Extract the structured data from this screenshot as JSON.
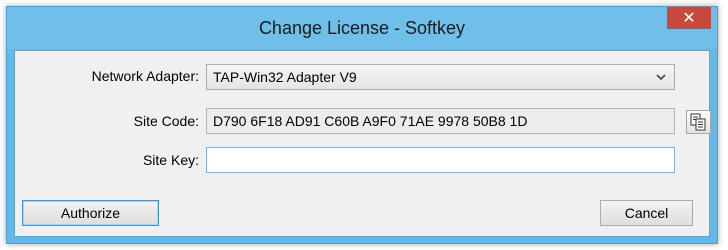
{
  "window": {
    "title": "Change License - Softkey",
    "close_glyph": "✕"
  },
  "form": {
    "network_adapter_label": "Network Adapter:",
    "network_adapter_value": "TAP-Win32 Adapter V9",
    "site_code_label": "Site Code:",
    "site_code_value": "D790 6F18 AD91 C60B A9F0 71AE 9978 50B8 1D",
    "site_key_label": "Site Key:",
    "site_key_value": ""
  },
  "buttons": {
    "authorize": "Authorize",
    "cancel": "Cancel"
  },
  "icons": {
    "dropdown": "chevron-down-icon",
    "copy": "copy-icon",
    "close": "close-icon"
  },
  "colors": {
    "titlebar": "#6fbfea",
    "close": "#c7493b",
    "client_bg": "#f0f0f0"
  }
}
